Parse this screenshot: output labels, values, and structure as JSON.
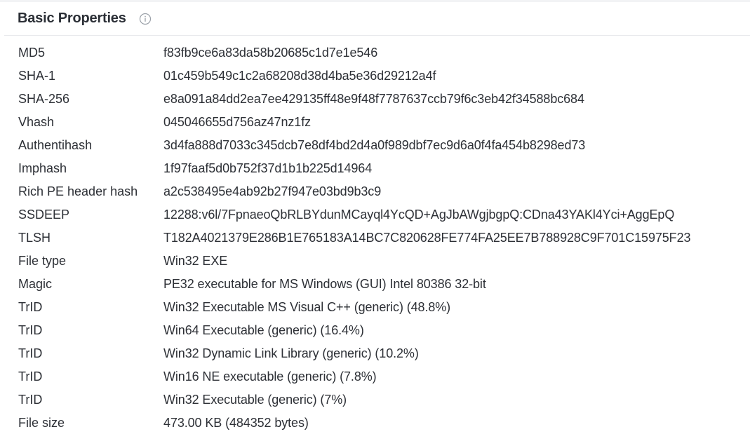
{
  "section": {
    "title": "Basic Properties",
    "info_icon": "info-circle-icon",
    "rows": [
      {
        "label": "MD5",
        "value": "f83fb9ce6a83da58b20685c1d7e1e546"
      },
      {
        "label": "SHA-1",
        "value": "01c459b549c1c2a68208d38d4ba5e36d29212a4f"
      },
      {
        "label": "SHA-256",
        "value": "e8a091a84dd2ea7ee429135ff48e9f48f7787637ccb79f6c3eb42f34588bc684"
      },
      {
        "label": "Vhash",
        "value": "045046655d756az47nz1fz"
      },
      {
        "label": "Authentihash",
        "value": "3d4fa888d7033c345dcb7e8df4bd2d4a0f989dbf7ec9d6a0f4fa454b8298ed73"
      },
      {
        "label": "Imphash",
        "value": "1f97faaf5d0b752f37d1b1b225d14964"
      },
      {
        "label": "Rich PE header hash",
        "value": "a2c538495e4ab92b27f947e03bd9b3c9"
      },
      {
        "label": "SSDEEP",
        "value": "12288:v6l/7FpnaeoQbRLBYdunMCayql4YcQD+AgJbAWgjbgpQ:CDna43YAKl4Yci+AggEpQ"
      },
      {
        "label": "TLSH",
        "value": "T182A4021379E286B1E765183A14BC7C820628FE774FA25EE7B788928C9F701C15975F23"
      },
      {
        "label": "File type",
        "value": "Win32 EXE"
      },
      {
        "label": "Magic",
        "value": "PE32 executable for MS Windows (GUI) Intel 80386 32-bit"
      },
      {
        "label": "TrID",
        "value": "Win32 Executable MS Visual C++ (generic) (48.8%)"
      },
      {
        "label": "TrID",
        "value": "Win64 Executable (generic) (16.4%)"
      },
      {
        "label": "TrID",
        "value": "Win32 Dynamic Link Library (generic) (10.2%)"
      },
      {
        "label": "TrID",
        "value": "Win16 NE executable (generic) (7.8%)"
      },
      {
        "label": "TrID",
        "value": "Win32 Executable (generic) (7%)"
      },
      {
        "label": "File size",
        "value": "473.00 KB (484352 bytes)"
      }
    ]
  }
}
